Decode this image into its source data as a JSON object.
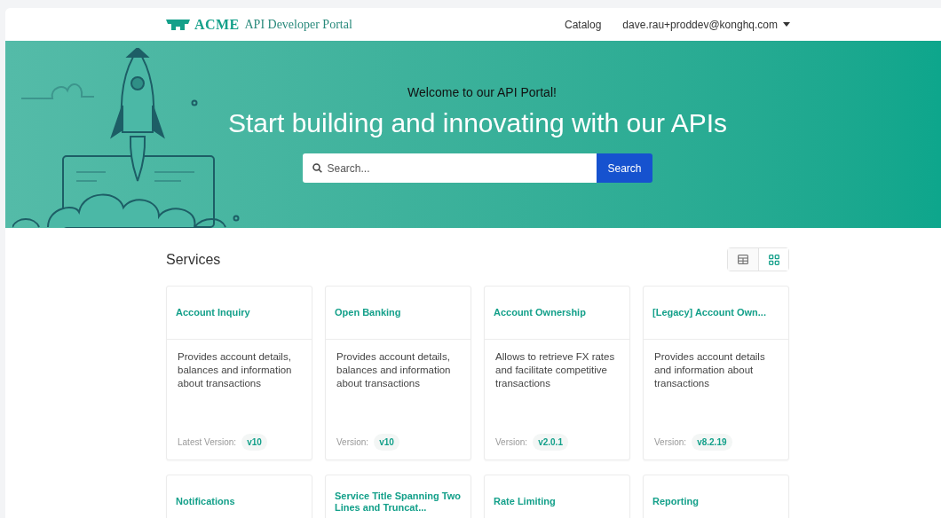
{
  "header": {
    "logo": "ACME",
    "portal_name": "API Developer Portal",
    "nav": [
      {
        "label": "Catalog"
      }
    ],
    "user": "dave.rau+proddev@konghq.com"
  },
  "hero": {
    "welcome": "Welcome to our API Portal!",
    "headline": "Start building and innovating with our APIs",
    "search": {
      "placeholder": "Search..."
    },
    "search_button": "Search"
  },
  "services": {
    "title": "Services",
    "view_toggle": [
      {
        "kind": "table",
        "selected": false
      },
      {
        "kind": "grid",
        "selected": true
      }
    ],
    "cards": [
      {
        "title": "Account Inquiry",
        "description": "Provides account details, balances and information about transactions",
        "version_label": "Latest Version:",
        "version": "v10"
      },
      {
        "title": "Open Banking",
        "description": "Provides account details, balances and information about transactions",
        "version_label": "Version:",
        "version": "v10"
      },
      {
        "title": "Account Ownership",
        "description": "Allows to retrieve FX rates and facilitate competitive transactions",
        "version_label": "Version:",
        "version": "v2.0.1"
      },
      {
        "title": "[Legacy] Account Own...",
        "description": "Provides account details and information about transactions",
        "version_label": "Version:",
        "version": "v8.2.19"
      },
      {
        "title": "Notifications"
      },
      {
        "title": "Service Title Spanning Two Lines and Truncat..."
      },
      {
        "title": "Rate Limiting"
      },
      {
        "title": "Reporting"
      }
    ]
  }
}
